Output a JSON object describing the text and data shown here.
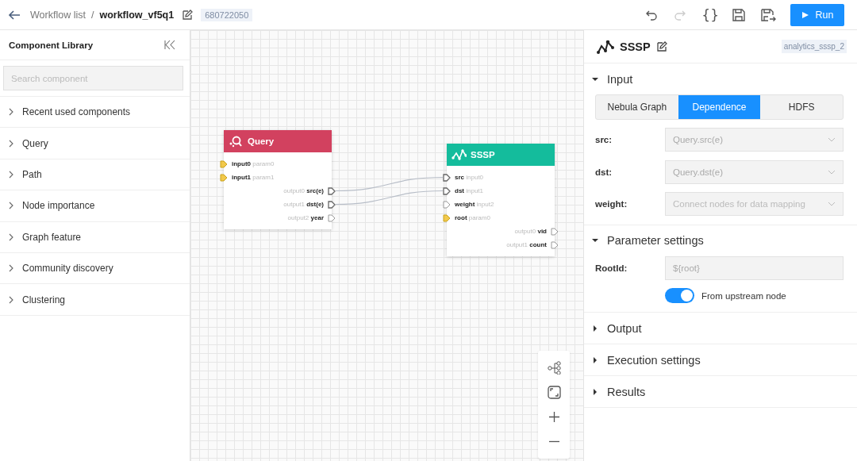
{
  "header": {
    "breadcrumb": "Workflow list",
    "separator": "/",
    "workflow_name": "workflow_vf5q1",
    "workflow_id": "680722050",
    "toolbar": [
      {
        "kind": "undo",
        "disabled": false
      },
      {
        "kind": "redo",
        "disabled": true
      },
      {
        "kind": "code",
        "label": "{}",
        "disabled": false
      },
      {
        "kind": "save",
        "disabled": false
      },
      {
        "kind": "save-as",
        "disabled": false
      }
    ],
    "run_button": "Run"
  },
  "sidebar": {
    "title": "Component Library",
    "search": {
      "placeholder": "Search component"
    },
    "categories": [
      {
        "label": "Recent used components",
        "expanded": false
      },
      {
        "label": "Query",
        "expanded": false
      },
      {
        "label": "Path",
        "expanded": false
      },
      {
        "label": "Node importance",
        "expanded": false
      },
      {
        "label": "Graph feature",
        "expanded": false
      },
      {
        "label": "Community discovery",
        "expanded": false
      },
      {
        "label": "Clustering",
        "expanded": false
      }
    ]
  },
  "canvas": {
    "nodes": [
      {
        "kind": "query",
        "title": "Query",
        "color": "#d2415f",
        "inputs": [
          {
            "name": "input0",
            "port": "param0",
            "kind": "param",
            "connected": false
          },
          {
            "name": "input1",
            "port": "param1",
            "kind": "param",
            "connected": false
          }
        ],
        "outputs": [
          {
            "name": "src(e)",
            "port": "output0",
            "connected": true
          },
          {
            "name": "dst(e)",
            "port": "output1",
            "connected": true
          },
          {
            "name": "year",
            "port": "output2",
            "connected": false
          }
        ]
      },
      {
        "kind": "sssp",
        "title": "SSSP",
        "color": "#14bc9c",
        "inputs": [
          {
            "name": "src",
            "port": "input0",
            "kind": "input",
            "connected": true
          },
          {
            "name": "dst",
            "port": "input1",
            "kind": "input",
            "connected": true
          },
          {
            "name": "weight",
            "port": "input2",
            "kind": "input",
            "connected": false
          },
          {
            "name": "root",
            "port": "param0",
            "kind": "param",
            "connected": false
          }
        ],
        "outputs": [
          {
            "name": "vid",
            "port": "output0",
            "connected": false
          },
          {
            "name": "count",
            "port": "output1",
            "connected": false
          }
        ]
      }
    ]
  },
  "panel": {
    "title": "SSSP",
    "node_id": "analytics_sssp_2",
    "sections": [
      {
        "kind": "input",
        "title": "Input",
        "expanded": true,
        "tabs": [
          {
            "label": "Nebula Graph",
            "selected": false
          },
          {
            "label": "Dependence",
            "selected": true
          },
          {
            "label": "HDFS",
            "selected": false
          }
        ],
        "fields": [
          {
            "kind": "select",
            "label": "src:",
            "value": "Query.src(e)",
            "disabled": true
          },
          {
            "kind": "select",
            "label": "dst:",
            "value": "Query.dst(e)",
            "disabled": true
          },
          {
            "kind": "select",
            "label": "weight:",
            "placeholder": "Connect nodes for data mapping",
            "disabled": true
          }
        ]
      },
      {
        "kind": "params",
        "title": "Parameter settings",
        "expanded": true,
        "fields": [
          {
            "kind": "input",
            "label": "RootId:",
            "value": "${root}",
            "disabled": true
          }
        ],
        "toggle": {
          "label": "From upstream node",
          "on": true
        }
      },
      {
        "kind": "plain",
        "title": "Output",
        "expanded": false
      },
      {
        "kind": "plain",
        "title": "Execution settings",
        "expanded": false
      },
      {
        "kind": "plain",
        "title": "Results",
        "expanded": false
      }
    ]
  }
}
